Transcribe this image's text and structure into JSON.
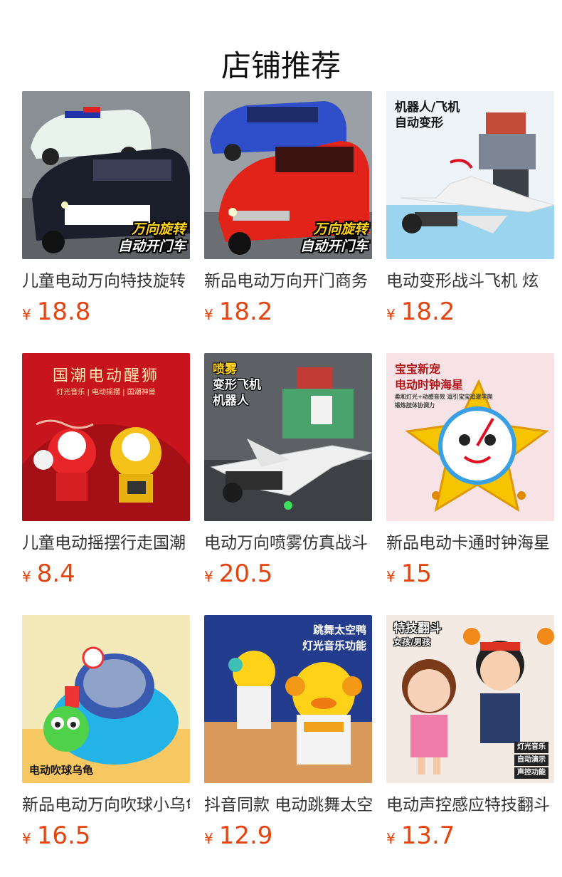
{
  "page": {
    "title": "店铺推荐"
  },
  "colors": {
    "price": "#e4450f",
    "title": "#111111",
    "name": "#333333"
  },
  "products": [
    {
      "name": "儿童电动万向特技旋转",
      "currency": "¥",
      "price": "18.8",
      "image_badge": [
        "万向旋转",
        "自动开门车"
      ],
      "icon": "police-car-toy-image"
    },
    {
      "name": "新品电动万向开门商务",
      "currency": "¥",
      "price": "18.2",
      "image_badge": [
        "万向旋转",
        "自动开门车"
      ],
      "icon": "red-van-toy-image"
    },
    {
      "name": "电动变形战斗飞机 炫",
      "currency": "¥",
      "price": "18.2",
      "image_text": [
        "机器人/飞机",
        "自动变形"
      ],
      "icon": "transforming-jet-toy-image"
    },
    {
      "name": "儿童电动摇摆行走国潮",
      "currency": "¥",
      "price": "8.4",
      "image_text": [
        "国潮电动醒狮",
        "灯光音乐 | 电动摇摆 | 国潮神兽"
      ],
      "icon": "lion-dance-toy-image"
    },
    {
      "name": "电动万向喷雾仿真战斗",
      "currency": "¥",
      "price": "20.5",
      "image_text": [
        "喷雾",
        "变形飞机",
        "机器人"
      ],
      "icon": "spray-jet-robot-toy-image"
    },
    {
      "name": "新品电动卡通时钟海星",
      "currency": "¥",
      "price": "15",
      "image_text": [
        "宝宝新宠",
        "电动时钟海星",
        "柔和灯光+动感音效 逗引宝宝追逐学爬",
        "锻炼肢体协调力"
      ],
      "icon": "starfish-clock-toy-image"
    },
    {
      "name": "新品电动万向吹球小乌龟",
      "currency": "¥",
      "price": "16.5",
      "image_text": [
        "电动吹球乌龟"
      ],
      "icon": "turtle-ball-toy-image"
    },
    {
      "name": "抖音同款 电动跳舞太空鸭",
      "currency": "¥",
      "price": "12.9",
      "image_text": [
        "跳舞太空鸭",
        "灯光音乐功能"
      ],
      "icon": "space-duck-toy-image"
    },
    {
      "name": "电动声控感应特技翻斗",
      "currency": "¥",
      "price": "13.7",
      "image_text": [
        "特技翻斗",
        "女孩/男孩",
        "灯光音乐",
        "自动演示",
        "声控功能"
      ],
      "icon": "flip-doll-toy-image"
    }
  ]
}
